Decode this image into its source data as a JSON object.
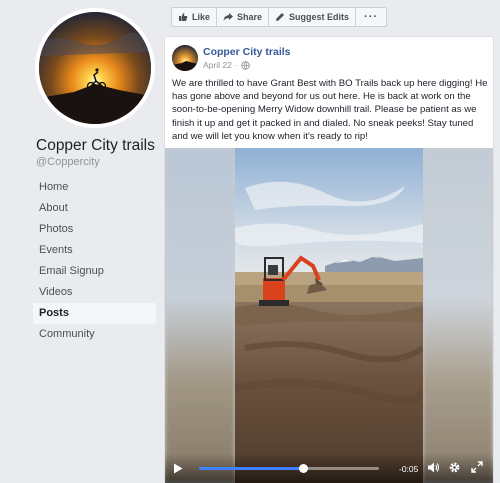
{
  "sidebar": {
    "page_name": "Copper City trails",
    "handle": "@Coppercity",
    "items": [
      {
        "label": "Home"
      },
      {
        "label": "About"
      },
      {
        "label": "Photos"
      },
      {
        "label": "Events"
      },
      {
        "label": "Email Signup"
      },
      {
        "label": "Videos"
      },
      {
        "label": "Posts",
        "active": true
      },
      {
        "label": "Community"
      }
    ]
  },
  "actions": {
    "like": "Like",
    "share": "Share",
    "suggest": "Suggest Edits",
    "more": "···"
  },
  "post": {
    "author": "Copper City trails",
    "date": "April 22",
    "privacy_sep": "·",
    "text": "We are thrilled to have Grant Best with BO Trails back up here digging! He has gone above and beyond for us out here. He is back at work on the soon-to-be-opening Merry Widow downhill trail. Please be patient as we finish it up and get it packed in and dialed. No sneak peeks! Stay tuned and we will let you know when it's ready to rip!"
  },
  "video": {
    "time_remaining": "-0:05",
    "progress_fraction": 0.58
  },
  "colors": {
    "link": "#365899",
    "progress": "#4080ff",
    "excavator": "#d9421c"
  },
  "icons": [
    "like-icon",
    "share-icon",
    "pencil-icon",
    "globe-icon",
    "play-icon",
    "volume-icon",
    "gear-icon",
    "fullscreen-icon"
  ]
}
